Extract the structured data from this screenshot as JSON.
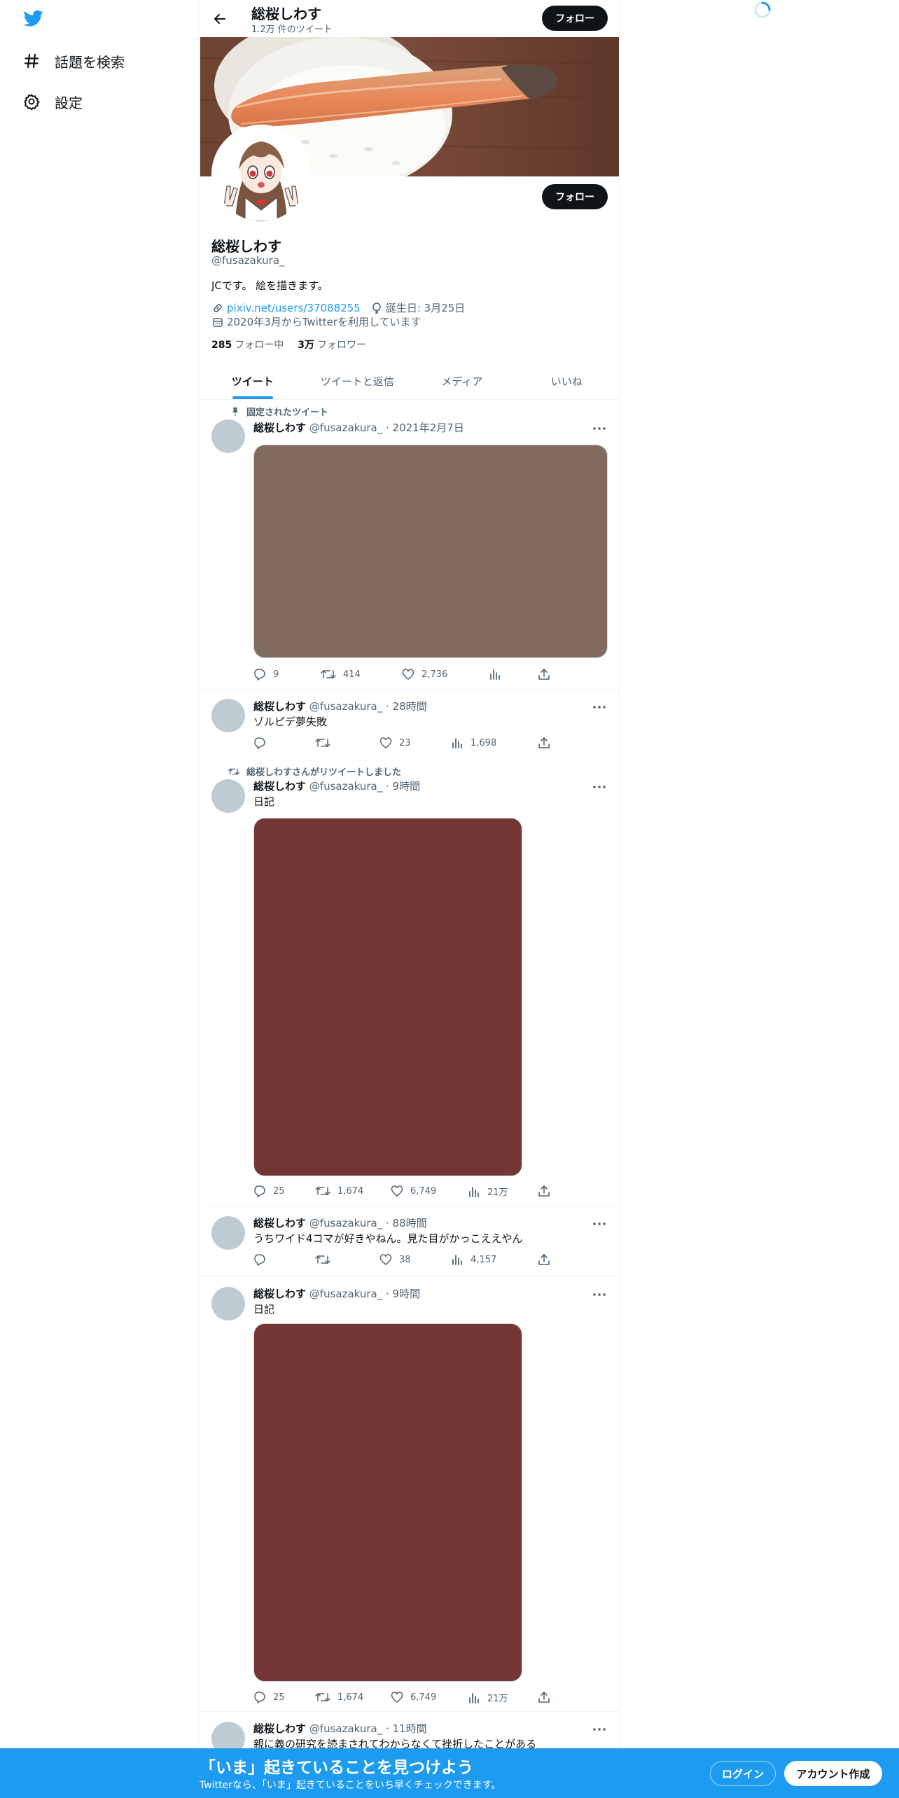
{
  "colors": {
    "accent": "#1d9bf0",
    "text": "#0f1419",
    "muted": "#536471",
    "media_brown": "#806b5e",
    "media_red": "#743535"
  },
  "sidebar": {
    "logo_icon": "twitter-bird-icon",
    "items": [
      {
        "label": "話題を検索",
        "icon": "hashtag-icon"
      },
      {
        "label": "設定",
        "icon": "gear-icon"
      }
    ]
  },
  "topbar": {
    "name": "総桜しわす",
    "tweet_count": "1.2万 件のツイート",
    "follow_label": "フォロー"
  },
  "profile": {
    "follow_label": "フォロー",
    "name": "総桜しわす",
    "handle": "@fusazakura_",
    "bio": "JCです。 絵を描きます。",
    "link": "pixiv.net/users/37088255",
    "birthday": "誕生日: 3月25日",
    "joined": "2020年3月からTwitterを利用しています",
    "following_count": "285",
    "following_label": "フォロー中",
    "followers_count": "3万",
    "followers_label": "フォロワー"
  },
  "tabs": [
    "ツイート",
    "ツイートと返信",
    "メディア",
    "いいね"
  ],
  "tweets": [
    {
      "context": "固定されたツイート",
      "name": "総桜しわす",
      "handle": "@fusazakura_ · 2021年2月7日",
      "text": "",
      "replies": "9",
      "retweets": "414",
      "likes": "2,736",
      "views": ""
    },
    {
      "context": "",
      "name": "総桜しわす",
      "handle": "@fusazakura_ · 28時間",
      "text": "ゾルピデ夢失敗",
      "replies": "",
      "retweets": "",
      "likes": "23",
      "views": "1,698"
    },
    {
      "context": "総桜しわすさんがリツイートしました",
      "name": "総桜しわす",
      "handle": "@fusazakura_ · 9時間",
      "text": "日記",
      "replies": "25",
      "retweets": "1,674",
      "likes": "6,749",
      "views": "21万"
    },
    {
      "context": "",
      "name": "総桜しわす",
      "handle": "@fusazakura_ · 88時間",
      "text": "うちワイド4コマが好きやねん。見た目がかっこええやん",
      "replies": "",
      "retweets": "",
      "likes": "38",
      "views": "4,157"
    },
    {
      "context": "",
      "name": "総桜しわす",
      "handle": "@fusazakura_ · 9時間",
      "text": "日記",
      "replies": "25",
      "retweets": "1,674",
      "likes": "6,749",
      "views": "21万"
    },
    {
      "context": "",
      "name": "総桜しわす",
      "handle": "@fusazakura_ · 11時間",
      "text": "親に義の研究を読まされてわからなくて挫折したことがある"
    }
  ],
  "bottombar": {
    "title": "「いま」起きていることを見つけよう",
    "subtitle": "Twitterなら、「いま」起きていることをいち早くチェックできます。",
    "login": "ログイン",
    "signup": "アカウント作成"
  }
}
